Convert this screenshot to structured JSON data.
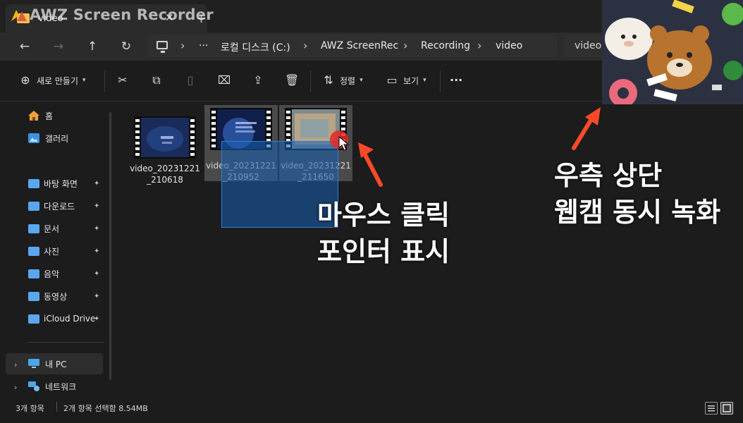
{
  "watermark": "AWZ Screen Recorder",
  "tab": {
    "title": "video",
    "close_glyph": "✕",
    "new_glyph": "+"
  },
  "nav": {
    "back": "←",
    "forward": "→",
    "up": "↑",
    "refresh": "↻",
    "breadcrumbs": [
      "로컬 디스크 (C:)",
      "AWZ ScreenRec",
      "Recording",
      "video"
    ],
    "more": "···",
    "search_text": "video"
  },
  "toolbar": {
    "new": "새로 만들기",
    "sort": "정렬",
    "view": "보기",
    "more": "···"
  },
  "sidebar": {
    "items": [
      {
        "label": "홈",
        "icon": "home-icon"
      },
      {
        "label": "갤러리",
        "icon": "gallery-icon"
      },
      {
        "label": "바탕 화면",
        "icon": "folder-icon",
        "pinned": true
      },
      {
        "label": "다운로드",
        "icon": "folder-icon",
        "pinned": true
      },
      {
        "label": "문서",
        "icon": "folder-icon",
        "pinned": true
      },
      {
        "label": "사진",
        "icon": "folder-icon",
        "pinned": true
      },
      {
        "label": "음악",
        "icon": "folder-icon",
        "pinned": true
      },
      {
        "label": "동영상",
        "icon": "folder-icon",
        "pinned": true
      },
      {
        "label": "iCloud Drive",
        "icon": "folder-icon",
        "pinned": true
      },
      {
        "label": "내 PC",
        "icon": "pc-icon"
      },
      {
        "label": "네트워크",
        "icon": "network-icon"
      }
    ],
    "pin_glyph": "📌"
  },
  "files": [
    {
      "name_line1": "video_20231221",
      "name_line2": "_210618",
      "selected": false
    },
    {
      "name_line1": "video_20231221",
      "name_line2": "_210952",
      "selected": true
    },
    {
      "name_line1": "video_20231221",
      "name_line2": "_211650",
      "selected": true
    }
  ],
  "annotations": {
    "mouse_line1": "마우스 클릭",
    "mouse_line2": "포인터 표시",
    "webcam_line1": "우측 상단",
    "webcam_line2": "웹캠 동시 녹화"
  },
  "status": {
    "count": "3개 항목",
    "selected": "2개 항목 선택함 8.54MB"
  },
  "colors": {
    "accent_arrow": "#ff4a2a",
    "folder_blue": "#5aa7f0",
    "selection": "#1860b4"
  }
}
